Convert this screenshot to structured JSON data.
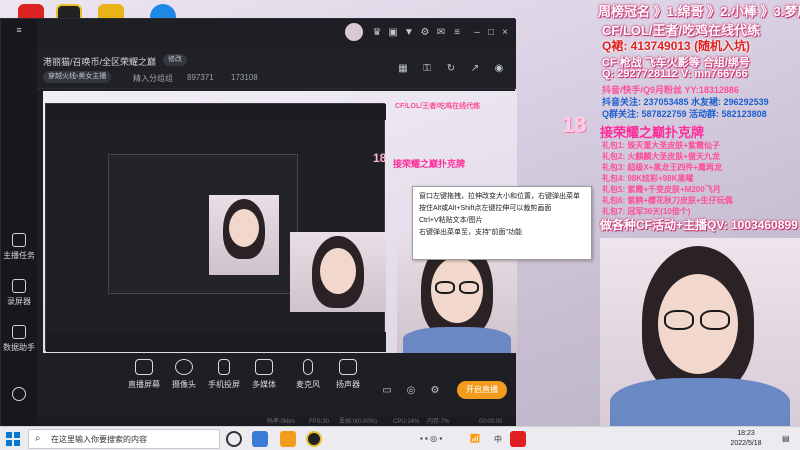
{
  "overlay": {
    "top_line": "周榜冠名 》1.绵哥 》2.小棒 》3.梦鹿",
    "line1": "CF/LOL/王者/吃鸡在线代练",
    "line2": "Q裙: 413749013 (随机入坑)",
    "line3": "CF 枪战 飞车火影等 合组/绑号",
    "line4": "Q: 2927728112 V: mn766766",
    "line5": "抖音/快手/Q9月粉丝 YY:18312886",
    "line6": "抖音关注: 237053485 水友裙: 296292539",
    "line7": "Q群关注: 587822759 活动群: 582123808",
    "badge_num": "18",
    "title": "接荣耀之巅扑克牌",
    "gifts": [
      "礼包1: 毁灭重大圣皮肤+紫霞仙子",
      "礼包2: 火麒麟大圣皮肤+傲天九龙",
      "礼包3: 超级X+黑龙王四件+鹰再龙",
      "礼包4: 98K炫彩+98K黑曜",
      "礼包5: 紫霞+千变皮肤+M200飞月",
      "礼包6: 紫鹤+樱花秋刀皮肤+生仔玩偶",
      "礼包7: 冠军30天(10倍个)"
    ],
    "banner": "做各种CF活动+主播QV: 1003460899"
  },
  "window": {
    "tab_title": "港丽猫/召唤币/全区荣耀之巅",
    "edit_label": "修改",
    "category": "穿越火线",
    "anchor_label": "美女主播",
    "channel_hint": "精入分组组",
    "stat1": "897371",
    "stat2": "173108",
    "sidebar": [
      {
        "label": "主播任务"
      },
      {
        "label": "录屏器"
      },
      {
        "label": "数据助手"
      }
    ],
    "controls": [
      {
        "label": "直播屏幕"
      },
      {
        "label": "摄像头"
      },
      {
        "label": "手机投屏"
      },
      {
        "label": "多媒体"
      },
      {
        "label": "麦克风"
      },
      {
        "label": "扬声器"
      }
    ],
    "go_live": "开启直播",
    "status": {
      "bitrate": "码率:0kb/s",
      "fps": "FPS:30",
      "dropped": "丢帧:0(0.00%)",
      "cpu": "CPU:24%",
      "mem": "内存:7%",
      "time": "00:00:00"
    },
    "context_menu": [
      "窗口左键拖拽，拉伸改变大小和位置，右键弹出菜单",
      "按住Alt或Alt+Shift点左键拉伸可以裁剪画面",
      "Ctrl+V粘贴文本/图片",
      "右键弹出菜单至，支持\"前面\"功能"
    ],
    "nested_badge": "18",
    "nested_title": "接荣耀之巅扑克牌"
  },
  "taskbar": {
    "search_placeholder": "在这里输入你要搜索的内容",
    "ime": "中",
    "time": "18:23",
    "date": "2022/5/18"
  },
  "colors": {
    "accent_orange": "#f29c1f",
    "overlay_pink": "#ff4d9a",
    "overlay_blue": "#1a5fd0",
    "window_dark": "#1e1f24"
  }
}
